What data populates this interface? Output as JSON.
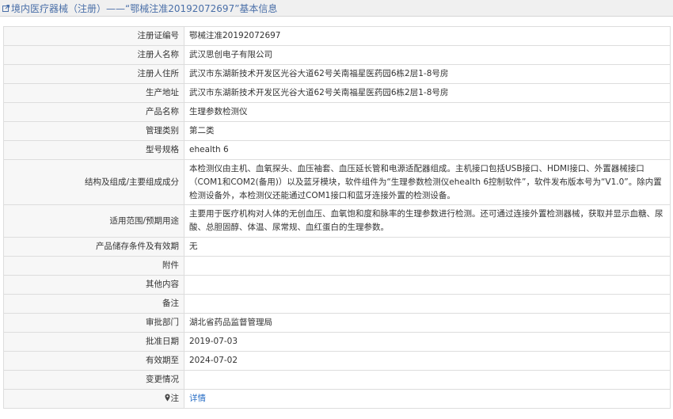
{
  "header": {
    "title": "境内医疗器械（注册）——“鄂械注准20192072697”基本信息"
  },
  "rows": [
    {
      "label": "注册证编号",
      "value": "鄂械注准20192072697"
    },
    {
      "label": "注册人名称",
      "value": "武汉思创电子有限公司"
    },
    {
      "label": "注册人住所",
      "value": "武汉市东湖新技术开发区光谷大道62号关南福星医药园6栋2层1-8号房"
    },
    {
      "label": "生产地址",
      "value": "武汉市东湖新技术开发区光谷大道62号关南福星医药园6栋2层1-8号房"
    },
    {
      "label": "产品名称",
      "value": "生理参数检测仪"
    },
    {
      "label": "管理类别",
      "value": "第二类"
    },
    {
      "label": "型号规格",
      "value": "ehealth 6"
    },
    {
      "label": "结构及组成/主要组成成分",
      "value": "本检测仪由主机、血氧探头、血压袖套、血压延长管和电源适配器组成。主机接口包括USB接口、HDMI接口、外置器械接口（COM1和COM2(备用)）以及蓝牙模块，软件组件为“生理参数检测仪ehealth 6控制软件”，软件发布版本号为“V1.0”。除内置检测设备外，本检测仪还能通过COM1接口和蓝牙连接外置的检测设备。"
    },
    {
      "label": "适用范围/预期用途",
      "value": "主要用于医疗机构对人体的无创血压、血氧饱和度和脉率的生理参数进行检测。还可通过连接外置检测器械，获取并显示血糖、尿酸、总胆固醇、体温、尿常规、血红蛋白的生理参数。"
    },
    {
      "label": "产品储存条件及有效期",
      "value": "无"
    },
    {
      "label": "附件",
      "value": ""
    },
    {
      "label": "其他内容",
      "value": ""
    },
    {
      "label": "备注",
      "value": ""
    },
    {
      "label": "审批部门",
      "value": "湖北省药品监督管理局"
    },
    {
      "label": "批准日期",
      "value": "2019-07-03"
    },
    {
      "label": "有效期至",
      "value": "2024-07-02"
    },
    {
      "label": "变更情况",
      "value": ""
    },
    {
      "label": "注",
      "value": "详情"
    }
  ],
  "colors": {
    "header_bg": "#f0f0f0",
    "header_text": "#4a6fa8",
    "label_bg": "#f7f7f7",
    "border": "#dddddd",
    "link": "#2a6fc6"
  },
  "icons": {
    "header": "external-link-icon",
    "note": "map-pin-icon"
  }
}
